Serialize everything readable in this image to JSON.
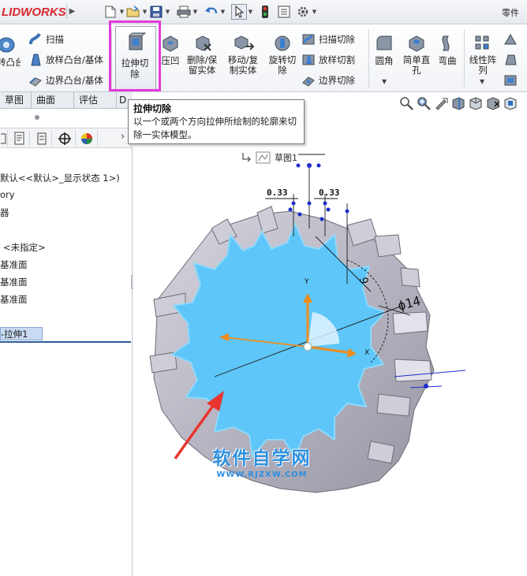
{
  "app": {
    "logo_text": "LIDWORKS",
    "document_name": "零件"
  },
  "quick_access": {
    "icons": [
      "new-document-icon",
      "open-folder-icon",
      "save-icon",
      "print-icon",
      "undo-icon",
      "select-pointer-icon",
      "rebuild-traffic-light-icon",
      "file-properties-icon",
      "options-gear-icon"
    ]
  },
  "ribbon": {
    "revolve_boss_label": "转凸台/基体",
    "sweep_label": "扫描",
    "loft_boss_label": "放样凸台/基体",
    "boundary_boss_label": "边界凸台/基体",
    "extrude_cut_label": "拉伸切除",
    "indent_label": "压凹",
    "delete_keep_label": "删除/保留实体",
    "move_copy_label": "移动/复制实体",
    "revolve_cut_label": "旋转切除",
    "swept_cut_label": "扫描切除",
    "lofted_cut_label": "放样切割",
    "boundary_cut_label": "边界切除",
    "fillet_label": "圆角",
    "simple_hole_label": "简单直孔",
    "flex_label": "弯曲",
    "linear_pattern_label": "线性阵列"
  },
  "manager_tabs": [
    {
      "label": "草图"
    },
    {
      "label": "曲面"
    },
    {
      "label": "评估"
    },
    {
      "label": "D"
    }
  ],
  "feature_tree": {
    "config_line": "默认<<默认>_显示状态 1>)",
    "history_line": "ory",
    "sensors_line": "器",
    "material_line": "<未指定>",
    "plane_1": "基准面",
    "plane_2": "基准面",
    "plane_3": "基准面",
    "extrude_feature": "-拉伸1"
  },
  "tooltip": {
    "title": "拉伸切除",
    "description": "以一个或两个方向拉伸所绘制的轮廓来切除一实体模型。"
  },
  "sketch_chip": {
    "label": "草图1"
  },
  "dimensions": {
    "left_offset": "0.33",
    "right_offset": "0.33",
    "vertical_dim": "9",
    "diameter": "ϕ14",
    "axis_y": "Y",
    "axis_x": "X"
  },
  "watermark": {
    "title": "软件自学网",
    "url": "WWW.RJZXW.COM"
  },
  "colors": {
    "highlight_magenta": "#e23adb",
    "gear_face_blue": "#5ec6f8",
    "gear_body_gray": "#b9b7c3",
    "arrow_red": "#e8352d",
    "axis_orange": "#f08c1a",
    "watermark_blue": "#2b8fe0"
  }
}
